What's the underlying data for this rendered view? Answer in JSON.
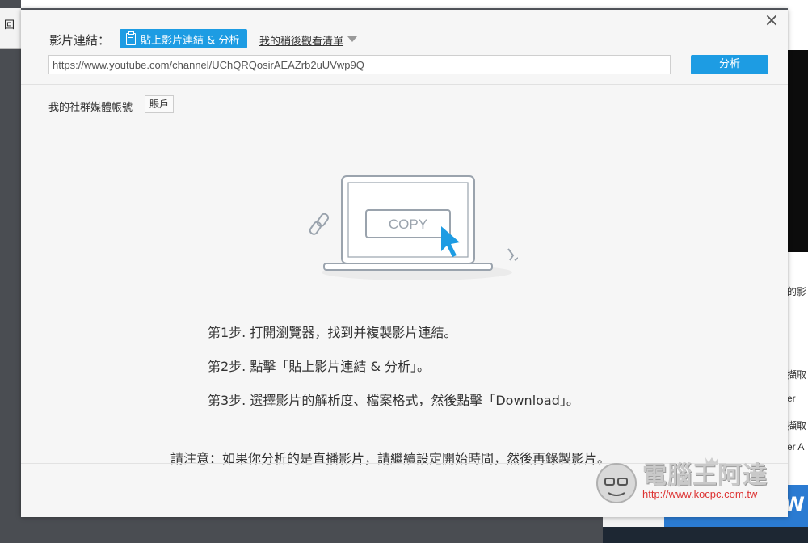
{
  "background": {
    "left_glyph": "回",
    "right_texts": [
      "的影",
      "擷取",
      "er",
      "擷取",
      "er A"
    ],
    "tile_text": "W"
  },
  "dialog": {
    "close_label": "×",
    "link_label": "影片連結：",
    "paste_button": "貼上影片連結 & 分析",
    "watchlist_link": "我的稍後觀看清單",
    "url_value": "https://www.youtube.com/channel/UChQRQosirAEAZrb2uUVwp9Q",
    "analyze_button": "分析",
    "social_label": "我的社群媒體帳號",
    "account_button": "賬戶",
    "illustration": {
      "copy_label": "COPY",
      "accent_color": "#1d9ce3"
    },
    "steps": [
      "第1步. 打開瀏覽器，找到并複製影片連結。",
      "第2步. 點擊「貼上影片連結 & 分析」。",
      "第3步. 選擇影片的解析度、檔案格式，然後點擊「Download」。"
    ],
    "note": "請注意：如果你分析的是直播影片，請繼續設定開始時間，然後再錄製影片。"
  },
  "watermark": {
    "name": "電腦王阿達",
    "url": "http://www.kocpc.com.tw"
  }
}
